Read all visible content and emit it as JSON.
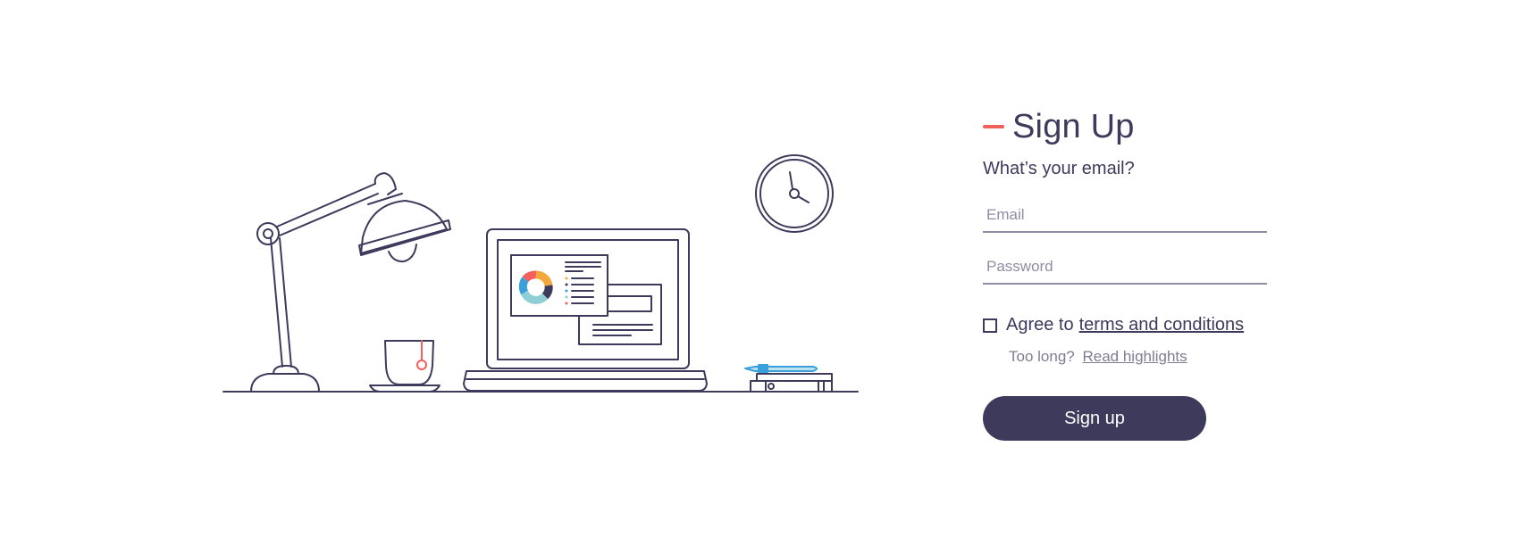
{
  "form": {
    "title": "Sign Up",
    "question": "What’s your email?",
    "email_placeholder": "Email",
    "password_placeholder": "Password",
    "agree_text": "Agree to",
    "terms_link": "terms and conditions",
    "hint_text": "Too long?",
    "hint_link": "Read highlights",
    "submit_label": "Sign up"
  },
  "colors": {
    "primary": "#3d3a5c",
    "accent": "#f25f5c",
    "muted": "#8f8ca3"
  }
}
